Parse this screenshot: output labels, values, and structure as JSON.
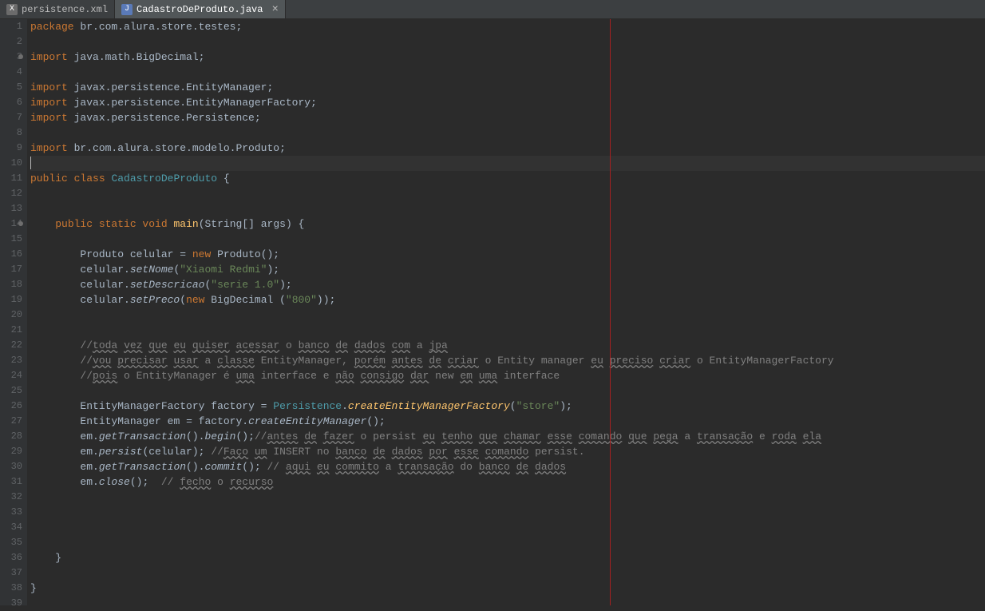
{
  "tabs": [
    {
      "label": "persistence.xml",
      "icon": "X",
      "iconClass": "xml-icon",
      "active": false
    },
    {
      "label": "CadastroDeProduto.java",
      "icon": "J",
      "iconClass": "java-icon",
      "active": true
    }
  ],
  "code": {
    "lines": [
      {
        "n": 1,
        "segs": [
          [
            "kw",
            "package"
          ],
          [
            "",
            " "
          ],
          [
            "pkg",
            "br.com.alura.store.testes;"
          ]
        ]
      },
      {
        "n": 2,
        "segs": []
      },
      {
        "n": 3,
        "mark": true,
        "segs": [
          [
            "kw",
            "import"
          ],
          [
            "",
            " "
          ],
          [
            "pkg",
            "java.math.BigDecimal;"
          ]
        ]
      },
      {
        "n": 4,
        "segs": []
      },
      {
        "n": 5,
        "segs": [
          [
            "kw",
            "import"
          ],
          [
            "",
            " "
          ],
          [
            "pkg",
            "javax.persistence.EntityManager;"
          ]
        ]
      },
      {
        "n": 6,
        "segs": [
          [
            "kw",
            "import"
          ],
          [
            "",
            " "
          ],
          [
            "pkg",
            "javax.persistence.EntityManagerFactory;"
          ]
        ]
      },
      {
        "n": 7,
        "segs": [
          [
            "kw",
            "import"
          ],
          [
            "",
            " "
          ],
          [
            "pkg",
            "javax.persistence.Persistence;"
          ]
        ]
      },
      {
        "n": 8,
        "segs": []
      },
      {
        "n": 9,
        "segs": [
          [
            "kw",
            "import"
          ],
          [
            "",
            " "
          ],
          [
            "pkg",
            "br.com.alura.store.modelo.Produto;"
          ]
        ]
      },
      {
        "n": 10,
        "current": true,
        "segs": [
          [
            "cursor",
            ""
          ]
        ]
      },
      {
        "n": 11,
        "segs": [
          [
            "kw",
            "public class"
          ],
          [
            "",
            " "
          ],
          [
            "cls",
            "CadastroDeProduto"
          ],
          [
            "",
            " {"
          ]
        ]
      },
      {
        "n": 12,
        "segs": []
      },
      {
        "n": 13,
        "segs": []
      },
      {
        "n": 14,
        "mark": true,
        "segs": [
          [
            "",
            "    "
          ],
          [
            "kw",
            "public static void"
          ],
          [
            "",
            " "
          ],
          [
            "method-decl",
            "main"
          ],
          [
            "",
            "("
          ],
          [
            "type",
            "String"
          ],
          [
            "",
            "[] "
          ],
          [
            "ident",
            "args"
          ],
          [
            "",
            ") {"
          ]
        ]
      },
      {
        "n": 15,
        "segs": []
      },
      {
        "n": 16,
        "segs": [
          [
            "",
            "        "
          ],
          [
            "type",
            "Produto"
          ],
          [
            "",
            " celular = "
          ],
          [
            "kw",
            "new"
          ],
          [
            "",
            " "
          ],
          [
            "type",
            "Produto"
          ],
          [
            "",
            "();"
          ]
        ]
      },
      {
        "n": 17,
        "segs": [
          [
            "",
            "        celular."
          ],
          [
            "methodcall",
            "setNome"
          ],
          [
            "",
            "("
          ],
          [
            "str",
            "\"Xiaomi Redmi\""
          ],
          [
            "",
            ");"
          ]
        ]
      },
      {
        "n": 18,
        "segs": [
          [
            "",
            "        celular."
          ],
          [
            "methodcall",
            "setDescricao"
          ],
          [
            "",
            "("
          ],
          [
            "str",
            "\"serie 1.0\""
          ],
          [
            "",
            ");"
          ]
        ]
      },
      {
        "n": 19,
        "segs": [
          [
            "",
            "        celular."
          ],
          [
            "methodcall",
            "setPreco"
          ],
          [
            "",
            "("
          ],
          [
            "kw",
            "new"
          ],
          [
            "",
            " "
          ],
          [
            "type",
            "BigDecimal"
          ],
          [
            "",
            " ("
          ],
          [
            "str",
            "\"800\""
          ],
          [
            "",
            "));"
          ]
        ]
      },
      {
        "n": 20,
        "segs": []
      },
      {
        "n": 21,
        "segs": []
      },
      {
        "n": 22,
        "segs": [
          [
            "",
            "        "
          ],
          [
            "com",
            "//"
          ],
          [
            "com spell",
            "toda"
          ],
          [
            "com",
            " "
          ],
          [
            "com spell",
            "vez"
          ],
          [
            "com",
            " "
          ],
          [
            "com spell",
            "que"
          ],
          [
            "com",
            " "
          ],
          [
            "com spell",
            "eu"
          ],
          [
            "com",
            " "
          ],
          [
            "com spell",
            "quiser"
          ],
          [
            "com",
            " "
          ],
          [
            "com spell",
            "acessar"
          ],
          [
            "com",
            " o "
          ],
          [
            "com spell",
            "banco"
          ],
          [
            "com",
            " "
          ],
          [
            "com spell",
            "de"
          ],
          [
            "com",
            " "
          ],
          [
            "com spell",
            "dados"
          ],
          [
            "com",
            " "
          ],
          [
            "com spell",
            "com"
          ],
          [
            "com",
            " a "
          ],
          [
            "com spell",
            "jpa"
          ]
        ]
      },
      {
        "n": 23,
        "segs": [
          [
            "",
            "        "
          ],
          [
            "com",
            "//"
          ],
          [
            "com spell",
            "vou"
          ],
          [
            "com",
            " "
          ],
          [
            "com spell",
            "precisar"
          ],
          [
            "com",
            " "
          ],
          [
            "com spell",
            "usar"
          ],
          [
            "com",
            " a "
          ],
          [
            "com spell",
            "classe"
          ],
          [
            "com",
            " EntityManager, "
          ],
          [
            "com spell",
            "porém"
          ],
          [
            "com",
            " "
          ],
          [
            "com spell",
            "antes"
          ],
          [
            "com",
            " "
          ],
          [
            "com spell",
            "de"
          ],
          [
            "com",
            " "
          ],
          [
            "com spell",
            "criar"
          ],
          [
            "com",
            " o Entity manager "
          ],
          [
            "com spell",
            "eu"
          ],
          [
            "com",
            " "
          ],
          [
            "com spell",
            "preciso"
          ],
          [
            "com",
            " "
          ],
          [
            "com spell",
            "criar"
          ],
          [
            "com",
            " o EntityManagerFactory"
          ]
        ]
      },
      {
        "n": 24,
        "segs": [
          [
            "",
            "        "
          ],
          [
            "com",
            "//"
          ],
          [
            "com spell",
            "pois"
          ],
          [
            "com",
            " o EntityManager é "
          ],
          [
            "com spell",
            "uma"
          ],
          [
            "com",
            " interface e "
          ],
          [
            "com spell",
            "não"
          ],
          [
            "com",
            " "
          ],
          [
            "com spell",
            "consigo"
          ],
          [
            "com",
            " "
          ],
          [
            "com spell",
            "dar"
          ],
          [
            "com",
            " new "
          ],
          [
            "com spell",
            "em"
          ],
          [
            "com",
            " "
          ],
          [
            "com spell",
            "uma"
          ],
          [
            "com",
            " interface"
          ]
        ]
      },
      {
        "n": 25,
        "segs": []
      },
      {
        "n": 26,
        "segs": [
          [
            "",
            "        "
          ],
          [
            "type",
            "EntityManagerFactory"
          ],
          [
            "",
            " "
          ],
          [
            "ident",
            "factory"
          ],
          [
            "",
            " = "
          ],
          [
            "cls",
            "Persistence"
          ],
          [
            "",
            "."
          ],
          [
            "annotation-yellow",
            "createEntityManagerFactory"
          ],
          [
            "",
            "("
          ],
          [
            "str",
            "\"store\""
          ],
          [
            "",
            ");"
          ]
        ]
      },
      {
        "n": 27,
        "segs": [
          [
            "",
            "        "
          ],
          [
            "type",
            "EntityManager"
          ],
          [
            "",
            " "
          ],
          [
            "ident",
            "em"
          ],
          [
            "",
            " = factory."
          ],
          [
            "methodcall",
            "createEntityManager"
          ],
          [
            "",
            "();"
          ]
        ]
      },
      {
        "n": 28,
        "segs": [
          [
            "",
            "        em."
          ],
          [
            "methodcall",
            "getTransaction"
          ],
          [
            "",
            "()."
          ],
          [
            "methodcall",
            "begin"
          ],
          [
            "",
            "();"
          ],
          [
            "com",
            "//"
          ],
          [
            "com spell",
            "antes"
          ],
          [
            "com",
            " "
          ],
          [
            "com spell",
            "de"
          ],
          [
            "com",
            " "
          ],
          [
            "com spell",
            "fazer"
          ],
          [
            "com",
            " o persist "
          ],
          [
            "com spell",
            "eu"
          ],
          [
            "com",
            " "
          ],
          [
            "com spell",
            "tenho"
          ],
          [
            "com",
            " "
          ],
          [
            "com spell",
            "que"
          ],
          [
            "com",
            " "
          ],
          [
            "com spell",
            "chamar"
          ],
          [
            "com",
            " "
          ],
          [
            "com spell",
            "esse"
          ],
          [
            "com",
            " "
          ],
          [
            "com spell",
            "comando"
          ],
          [
            "com",
            " "
          ],
          [
            "com spell",
            "que"
          ],
          [
            "com",
            " "
          ],
          [
            "com spell",
            "pega"
          ],
          [
            "com",
            " a "
          ],
          [
            "com spell",
            "transação"
          ],
          [
            "com",
            " e "
          ],
          [
            "com spell",
            "roda"
          ],
          [
            "com",
            " "
          ],
          [
            "com spell",
            "ela"
          ]
        ]
      },
      {
        "n": 29,
        "segs": [
          [
            "",
            "        em."
          ],
          [
            "methodcall",
            "persist"
          ],
          [
            "",
            "(celular); "
          ],
          [
            "com",
            "//"
          ],
          [
            "com spell",
            "Faço"
          ],
          [
            "com",
            " "
          ],
          [
            "com spell",
            "um"
          ],
          [
            "com",
            " INSERT no "
          ],
          [
            "com spell",
            "banco"
          ],
          [
            "com",
            " "
          ],
          [
            "com spell",
            "de"
          ],
          [
            "com",
            " "
          ],
          [
            "com spell",
            "dados"
          ],
          [
            "com",
            " "
          ],
          [
            "com spell",
            "por"
          ],
          [
            "com",
            " "
          ],
          [
            "com spell",
            "esse"
          ],
          [
            "com",
            " "
          ],
          [
            "com spell",
            "comando"
          ],
          [
            "com",
            " persist."
          ]
        ]
      },
      {
        "n": 30,
        "segs": [
          [
            "",
            "        em."
          ],
          [
            "methodcall",
            "getTransaction"
          ],
          [
            "",
            "()."
          ],
          [
            "methodcall",
            "commit"
          ],
          [
            "",
            "(); "
          ],
          [
            "com",
            "// "
          ],
          [
            "com spell",
            "aqui"
          ],
          [
            "com",
            " "
          ],
          [
            "com spell",
            "eu"
          ],
          [
            "com",
            " "
          ],
          [
            "com spell",
            "commito"
          ],
          [
            "com",
            " a "
          ],
          [
            "com spell",
            "transação"
          ],
          [
            "com",
            " do "
          ],
          [
            "com spell",
            "banco"
          ],
          [
            "com",
            " "
          ],
          [
            "com spell",
            "de"
          ],
          [
            "com",
            " "
          ],
          [
            "com spell",
            "dados"
          ]
        ]
      },
      {
        "n": 31,
        "segs": [
          [
            "",
            "        em."
          ],
          [
            "methodcall",
            "close"
          ],
          [
            "",
            "();  "
          ],
          [
            "com",
            "// "
          ],
          [
            "com spell",
            "fecho"
          ],
          [
            "com",
            " o "
          ],
          [
            "com spell",
            "recurso"
          ]
        ]
      },
      {
        "n": 32,
        "segs": []
      },
      {
        "n": 33,
        "segs": []
      },
      {
        "n": 34,
        "segs": []
      },
      {
        "n": 35,
        "segs": []
      },
      {
        "n": 36,
        "segs": [
          [
            "",
            "    }"
          ]
        ]
      },
      {
        "n": 37,
        "segs": []
      },
      {
        "n": 38,
        "segs": [
          [
            "",
            "}"
          ]
        ]
      },
      {
        "n": 39,
        "segs": []
      }
    ]
  }
}
